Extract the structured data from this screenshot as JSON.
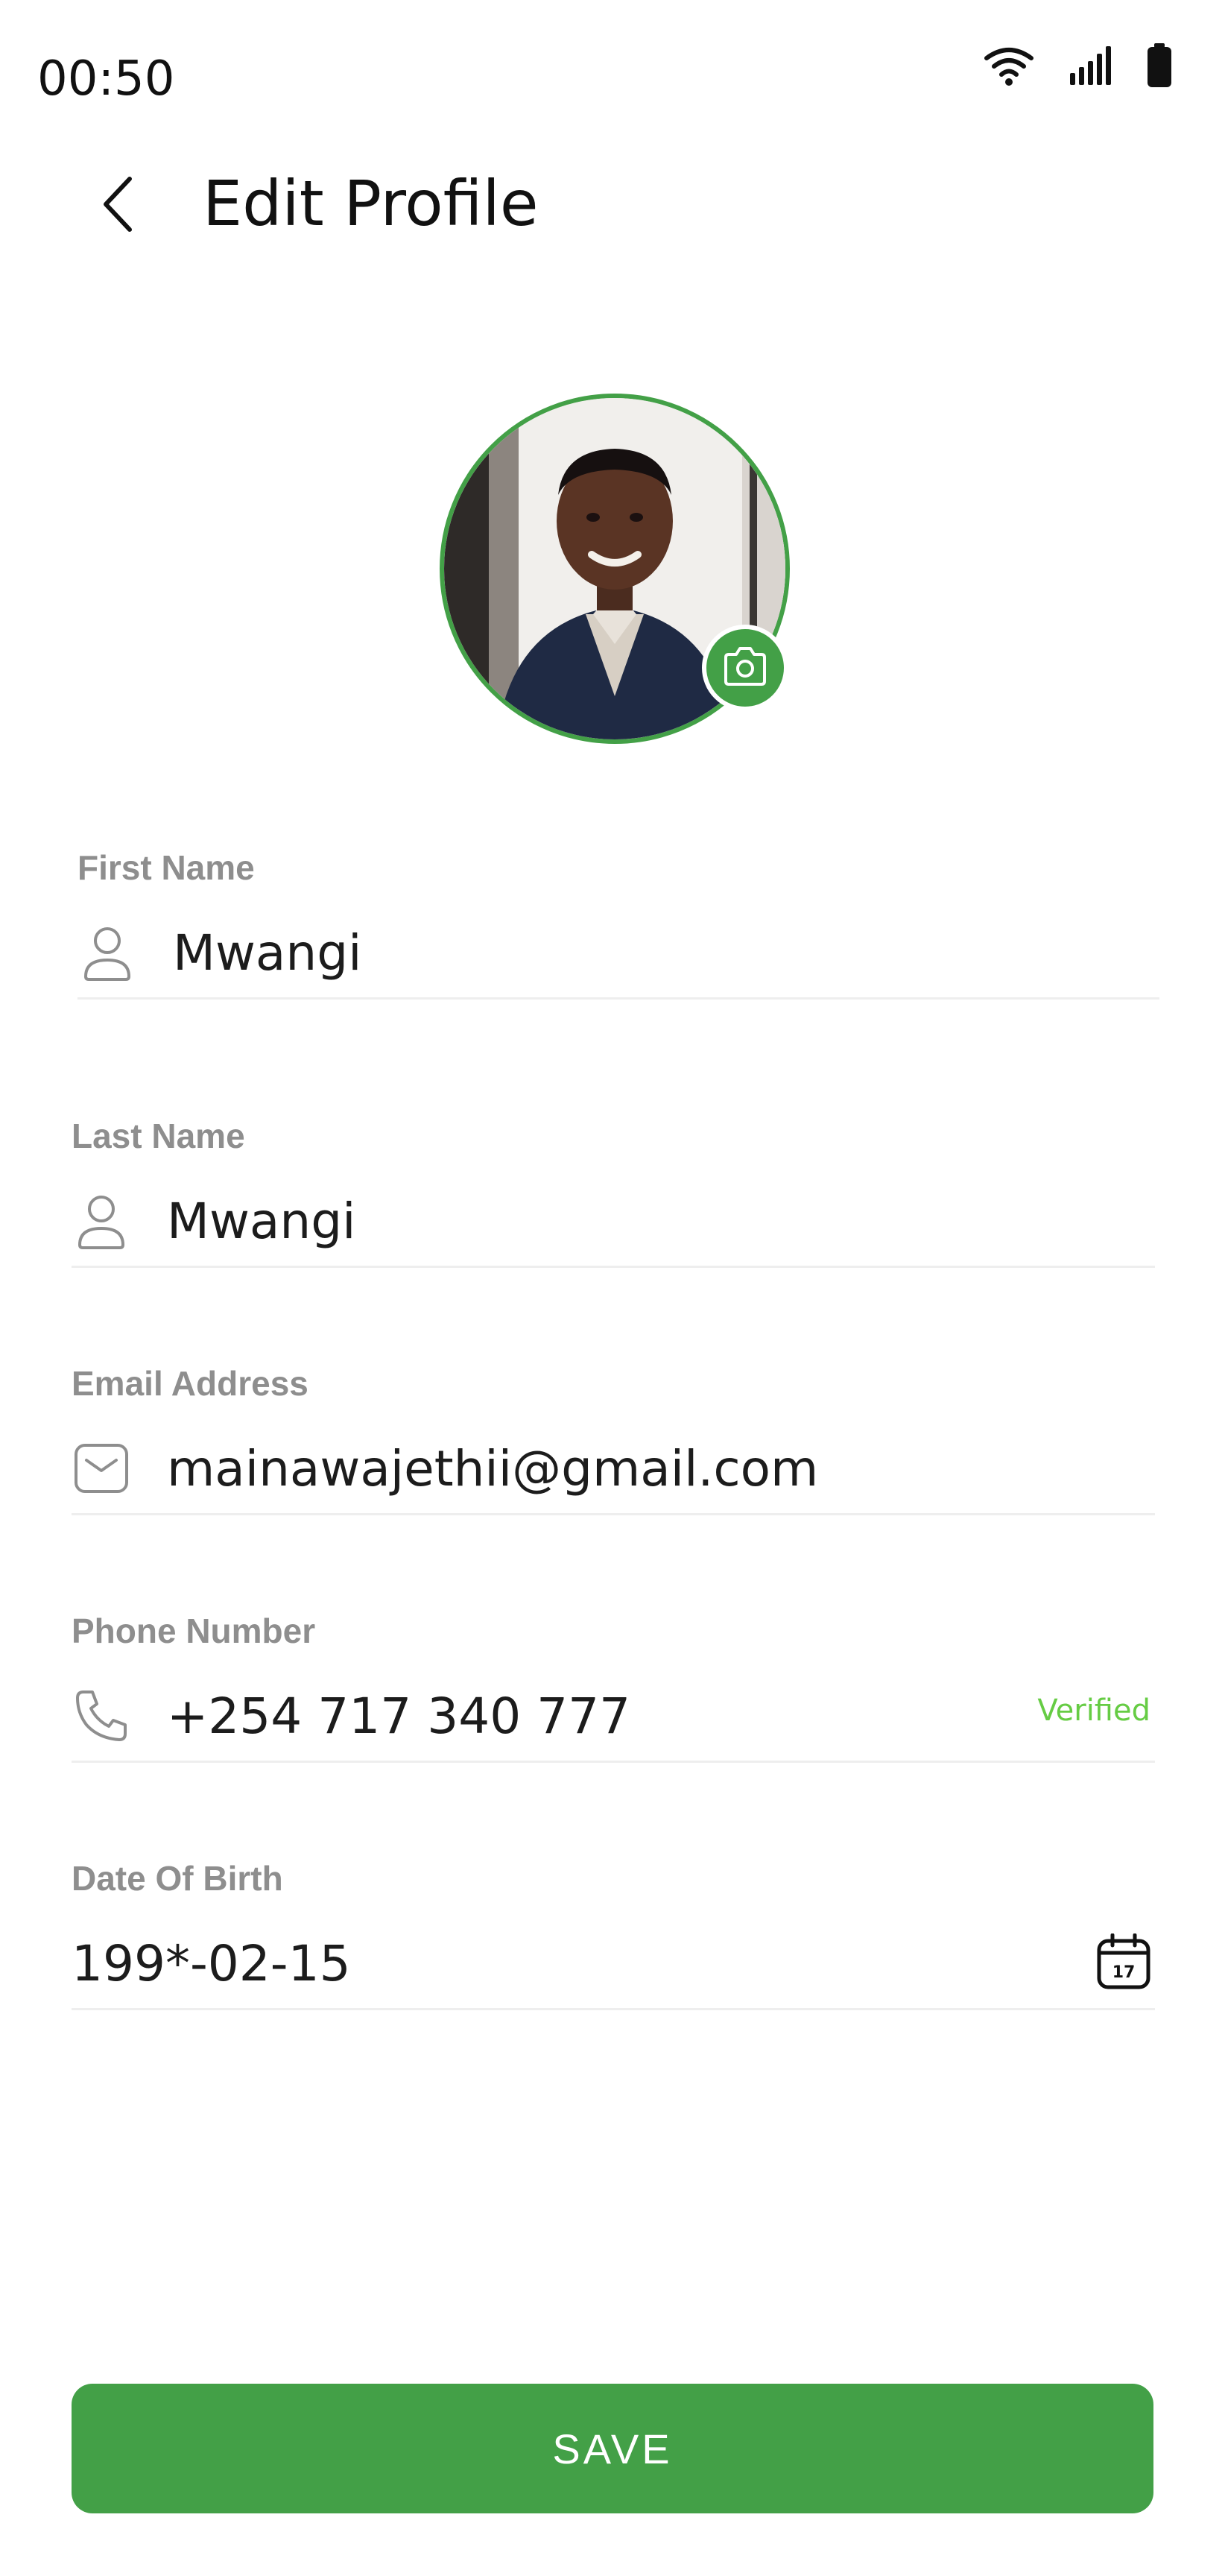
{
  "status_bar": {
    "time": "00:50",
    "icons": [
      "wifi-icon",
      "signal-icon",
      "battery-icon"
    ]
  },
  "header": {
    "back_icon": "chevron-left-icon",
    "title": "Edit Profile"
  },
  "avatar": {
    "camera_icon": "camera-icon",
    "border_color": "#43a047"
  },
  "form": {
    "first_name": {
      "label": "First Name",
      "value": "Mwangi",
      "icon": "person-icon"
    },
    "last_name": {
      "label": "Last Name",
      "value": "Mwangi",
      "icon": "person-icon"
    },
    "email": {
      "label": "Email Address",
      "value": "mainawajethii@gmail.com",
      "icon": "mail-icon"
    },
    "phone": {
      "label": "Phone Number",
      "value": "+254 717 340 777",
      "status": "Verified",
      "icon": "phone-icon"
    },
    "dob": {
      "label": "Date Of Birth",
      "value": "199*-02-15",
      "calendar_day": "17",
      "icon": "calendar-icon"
    }
  },
  "actions": {
    "save_label": "SAVE"
  },
  "colors": {
    "accent": "#43a047",
    "verified": "#66cc44",
    "label": "#8e8e8e",
    "divider": "#eeeeee"
  }
}
